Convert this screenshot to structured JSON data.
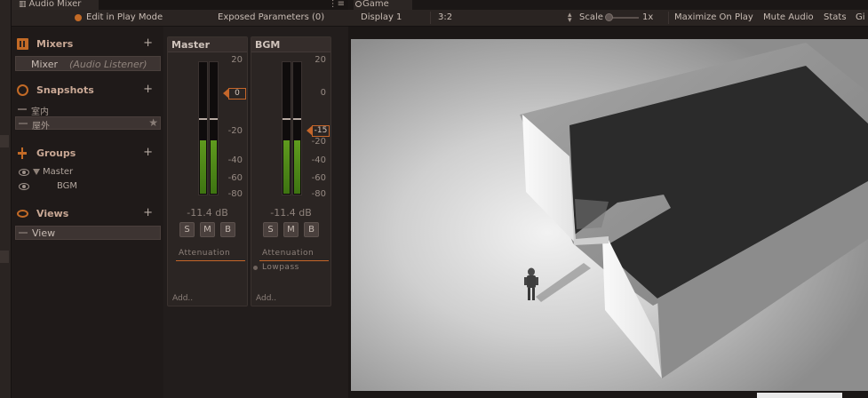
{
  "mixer": {
    "tab_title": "Audio Mixer",
    "play_mode_label": "Edit in Play Mode",
    "exposed_params_label": "Exposed Parameters (0)",
    "sections": {
      "mixers": {
        "title": "Mixers",
        "items": [
          {
            "name": "Mixer",
            "sub": "(Audio Listener)"
          }
        ]
      },
      "snapshots": {
        "title": "Snapshots",
        "items": [
          "室内",
          "屋外"
        ]
      },
      "groups": {
        "title": "Groups",
        "items": [
          "Master",
          "BGM"
        ]
      },
      "views": {
        "title": "Views",
        "items": [
          "View"
        ]
      }
    },
    "add_symbol": "+",
    "star_symbol": "★",
    "strips": [
      {
        "name": "Master",
        "db_readout": "-11.4 dB",
        "fader_value": "0",
        "level": 0.4,
        "buttons": [
          "S",
          "M",
          "B"
        ],
        "effects": [
          "Attenuation"
        ],
        "add_label": "Add.."
      },
      {
        "name": "BGM",
        "db_readout": "-11.4 dB",
        "fader_value": "-15",
        "level": 0.4,
        "buttons": [
          "S",
          "M",
          "B"
        ],
        "effects": [
          "Attenuation",
          "Lowpass"
        ],
        "add_label": "Add.."
      }
    ],
    "scale_labels": [
      "20",
      "0",
      "-20",
      "-40",
      "-60",
      "-80"
    ],
    "bgm_scale_labels": [
      "20",
      "0",
      "-20",
      "-40",
      "-60",
      "-80"
    ]
  },
  "game": {
    "tab_title": "Game",
    "display": "Display 1",
    "aspect": "3:2",
    "scale_label": "Scale",
    "scale_value": "1x",
    "maximize_label": "Maximize On Play",
    "mute_label": "Mute Audio",
    "stats_label": "Stats",
    "gizmos_label": "Gi"
  },
  "colors": {
    "accent": "#c5662a",
    "meter_green": "#5f9a1e"
  }
}
